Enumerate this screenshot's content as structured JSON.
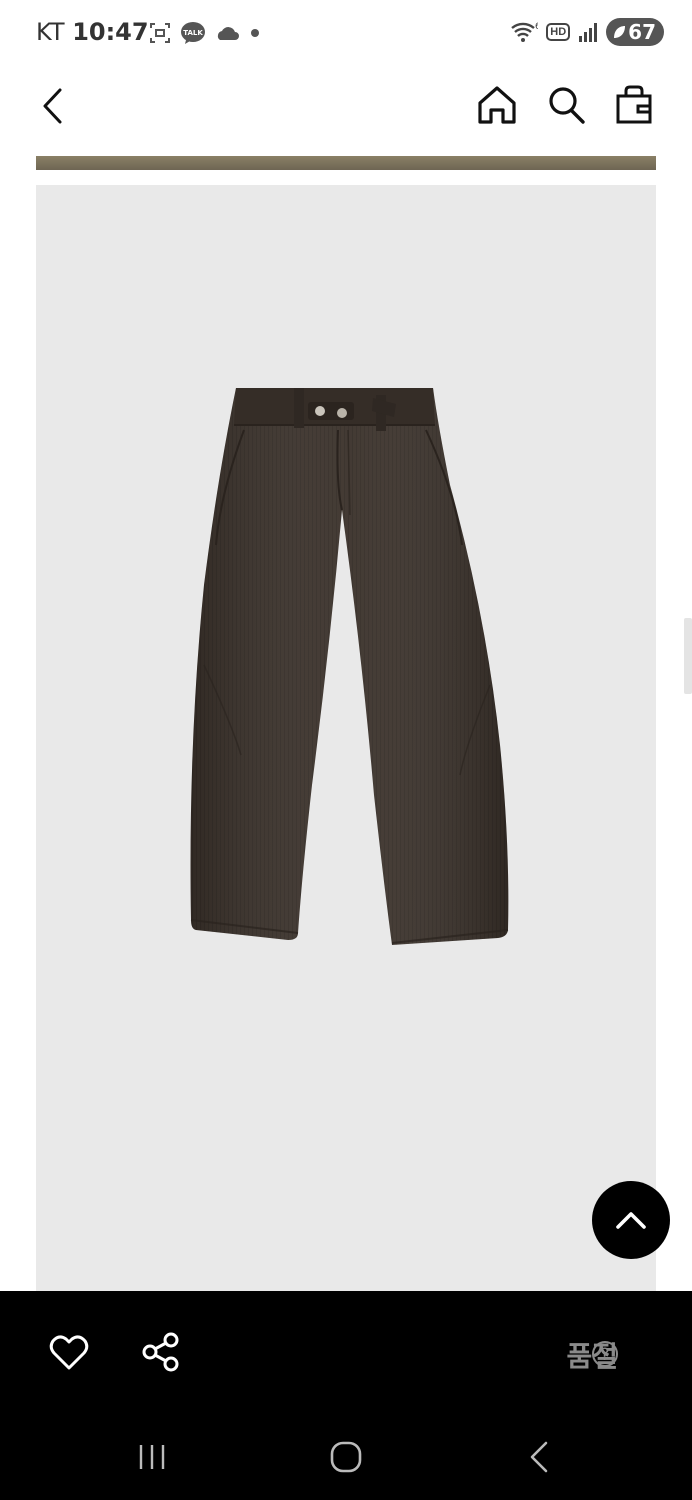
{
  "status_bar": {
    "carrier": "KT",
    "time": "10:47",
    "hd_label": "HD",
    "battery": "67",
    "icons": [
      "screenshot-icon",
      "kakaotalk-icon",
      "cloud-icon",
      "dot-icon",
      "wifi-icon",
      "signal-icon",
      "battery-icon"
    ]
  },
  "header": {
    "icons": [
      "back-arrow-icon",
      "home-icon",
      "search-icon",
      "shopping-bag-icon"
    ]
  },
  "product": {
    "image_subject": "dark brown corduroy trousers",
    "background_color": "#e9e9e9",
    "garment_color": "#3b322b"
  },
  "actions": {
    "soldout_label": "품절",
    "help_icon": "question-circle-icon",
    "like_icon": "heart-icon",
    "share_icon": "share-icon",
    "scroll_top_icon": "chevron-up-icon"
  },
  "system_nav": {
    "icons": [
      "recents-icon",
      "home-circle-icon",
      "back-icon"
    ]
  },
  "colors": {
    "accent_black": "#000000",
    "muted_text": "#8a8a8a",
    "divider": "#7c735d"
  }
}
